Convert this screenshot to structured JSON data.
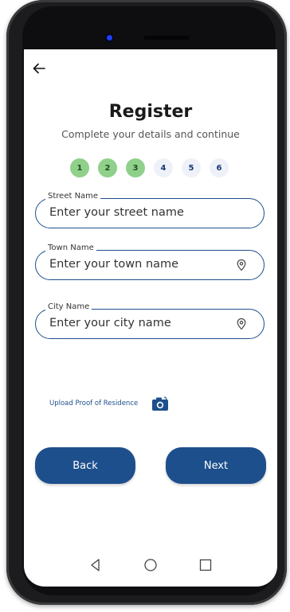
{
  "header": {
    "back_icon": "arrow-left-icon",
    "title": "Register",
    "subtitle": "Complete your details and continue"
  },
  "stepper": {
    "steps": [
      {
        "label": "1",
        "status": "done"
      },
      {
        "label": "2",
        "status": "done"
      },
      {
        "label": "3",
        "status": "done"
      },
      {
        "label": "4",
        "status": "pending"
      },
      {
        "label": "5",
        "status": "pending"
      },
      {
        "label": "6",
        "status": "pending"
      }
    ]
  },
  "form": {
    "street": {
      "label": "Street Name",
      "placeholder": "Enter your street name"
    },
    "town": {
      "label": "Town Name",
      "placeholder": "Enter your town name",
      "icon": "location-pin-icon"
    },
    "city": {
      "label": "City Name",
      "placeholder": "Enter your city name",
      "icon": "location-pin-icon"
    }
  },
  "upload": {
    "label": "Upload Proof of Residence",
    "icon": "camera-icon"
  },
  "buttons": {
    "back_label": "Back",
    "next_label": "Next"
  },
  "nav": {
    "icons": [
      "nav-back-icon",
      "nav-home-icon",
      "nav-recents-icon"
    ]
  },
  "colors": {
    "primary": "#1d4f8c",
    "step_done": "#8fd08b",
    "step_pending": "#eef2f8"
  }
}
